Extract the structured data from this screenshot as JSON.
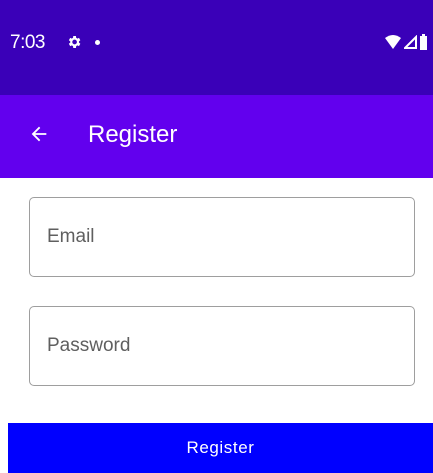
{
  "status_bar": {
    "time": "7:03",
    "icons": [
      "settings-gear-icon",
      "notification-dot-icon",
      "wifi-icon",
      "cellular-signal-icon",
      "battery-icon"
    ],
    "background": "#3a00b8"
  },
  "app_bar": {
    "title": "Register",
    "back_icon": "arrow-back-icon",
    "background": "#6200ee"
  },
  "form": {
    "email": {
      "value": "",
      "placeholder": "Email"
    },
    "password": {
      "value": "",
      "placeholder": "Password"
    }
  },
  "register_button": {
    "label": "Register",
    "background": "#0000ff"
  }
}
